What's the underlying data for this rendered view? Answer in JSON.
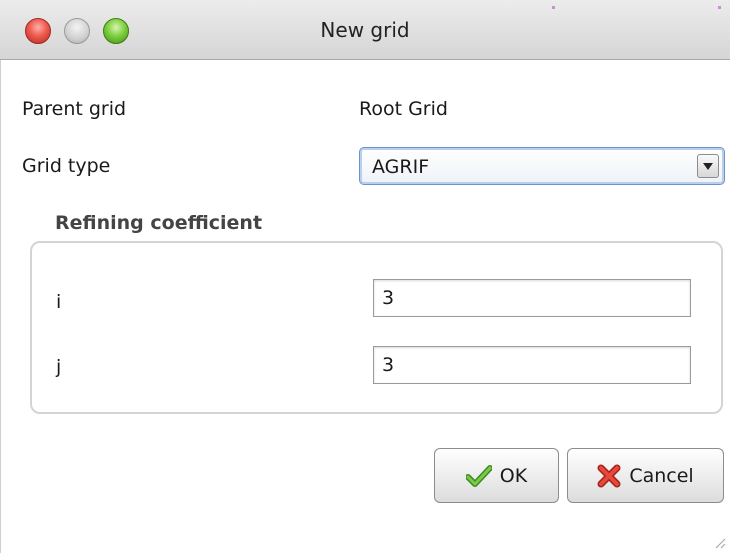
{
  "window": {
    "title": "New grid",
    "controls": {
      "close": "close-icon",
      "minimize": "minimize-icon",
      "zoom": "zoom-icon"
    }
  },
  "form": {
    "parent_grid_label": "Parent grid",
    "parent_grid_value": "Root Grid",
    "grid_type_label": "Grid type",
    "grid_type_value": "AGRIF"
  },
  "refining": {
    "title": "Refining coefficient",
    "i_label": "i",
    "i_value": "3",
    "j_label": "j",
    "j_value": "3"
  },
  "buttons": {
    "ok_label": "OK",
    "ok_icon": "checkmark-icon",
    "cancel_label": "Cancel",
    "cancel_icon": "x-icon"
  },
  "colors": {
    "ok_green": "#5aa02c",
    "cancel_red": "#d9382c",
    "focus_blue": "#6e93c8"
  }
}
